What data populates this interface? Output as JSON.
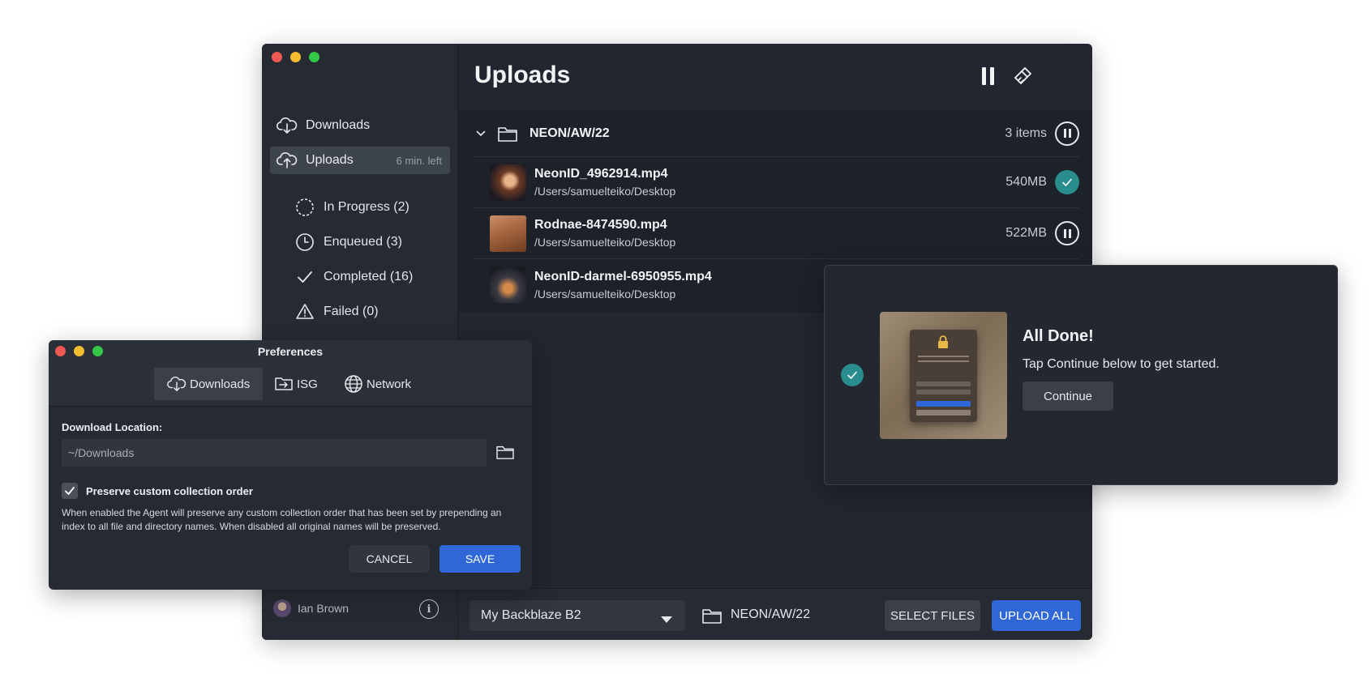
{
  "main": {
    "title": "Uploads",
    "sidebar": {
      "downloads_label": "Downloads",
      "uploads_label": "Uploads",
      "uploads_meta": "6 min. left",
      "sub_items": [
        {
          "label": "In Progress (2)",
          "icon": "dashed-circle-icon"
        },
        {
          "label": "Enqueued (3)",
          "icon": "clock-icon"
        },
        {
          "label": "Completed (16)",
          "icon": "check-icon"
        },
        {
          "label": "Failed (0)",
          "icon": "warning-icon"
        }
      ],
      "user_name": "Ian Brown"
    },
    "group": {
      "name": "NEON/AW/22",
      "count": "3 items"
    },
    "files": [
      {
        "name": "NeonID_4962914.mp4",
        "path": "/Users/samuelteiko/Desktop",
        "size": "540MB",
        "status": "completed"
      },
      {
        "name": "Rodnae-8474590.mp4",
        "path": "/Users/samuelteiko/Desktop",
        "size": "522MB",
        "status": "paused"
      },
      {
        "name": "NeonID-darmel-6950955.mp4",
        "path": "/Users/samuelteiko/Desktop",
        "size": "",
        "status": "queued"
      }
    ],
    "bottom": {
      "bucket": "My Backblaze B2",
      "folder": "NEON/AW/22",
      "select_files": "SELECT FILES",
      "upload_all": "UPLOAD ALL"
    }
  },
  "preferences": {
    "title": "Preferences",
    "tabs": [
      {
        "label": "Downloads",
        "icon": "cloud-download-icon"
      },
      {
        "label": "ISG",
        "icon": "isg-icon"
      },
      {
        "label": "Network",
        "icon": "globe-icon"
      }
    ],
    "download_location_label": "Download Location:",
    "download_location_value": "~/Downloads",
    "preserve_label": "Preserve custom collection order",
    "preserve_checked": true,
    "description": "When enabled the Agent will preserve any custom collection order that has been set by prepending an index to all file and directory names. When disabled all original names will be preserved.",
    "cancel": "CANCEL",
    "save": "SAVE"
  },
  "toast": {
    "title": "All Done!",
    "message": "Tap Continue below to get started.",
    "button": "Continue"
  },
  "colors": {
    "accent_blue": "#2f67d8",
    "success_teal": "#2a8d8d",
    "window_bg": "#232830"
  }
}
